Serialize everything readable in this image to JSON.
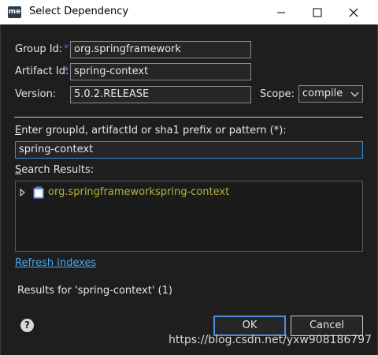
{
  "window": {
    "title": "Select Dependency",
    "app_icon_text": "me"
  },
  "form": {
    "group_id_label": "Group Id:",
    "group_id_value": "org.springframework",
    "artifact_id_label": "Artifact Id:",
    "artifact_id_value": "spring-context",
    "version_label": "Version:",
    "version_value": "5.0.2.RELEASE",
    "scope_label": "Scope:",
    "scope_value": "compile",
    "required_marker": "*"
  },
  "search": {
    "prompt_prefix": "E",
    "prompt_rest": "nter groupId, artifactId or sha1 prefix or pattern (*):",
    "query_value": "spring-context",
    "results_label_prefix": "S",
    "results_label_rest": "earch Results:"
  },
  "results": [
    {
      "group": "org.springframework",
      "artifact": "spring-context"
    }
  ],
  "refresh_link": "Refresh indexes",
  "status_text": "Results for 'spring-context' (1)",
  "buttons": {
    "ok": "OK",
    "cancel": "Cancel",
    "help": "?"
  },
  "watermark": "https://blog.csdn.net/yxw908186797",
  "colors": {
    "background": "#1e1e1e",
    "accent": "#3c8ed8",
    "result_text": "#b6b23a",
    "link": "#4aa8f0"
  }
}
